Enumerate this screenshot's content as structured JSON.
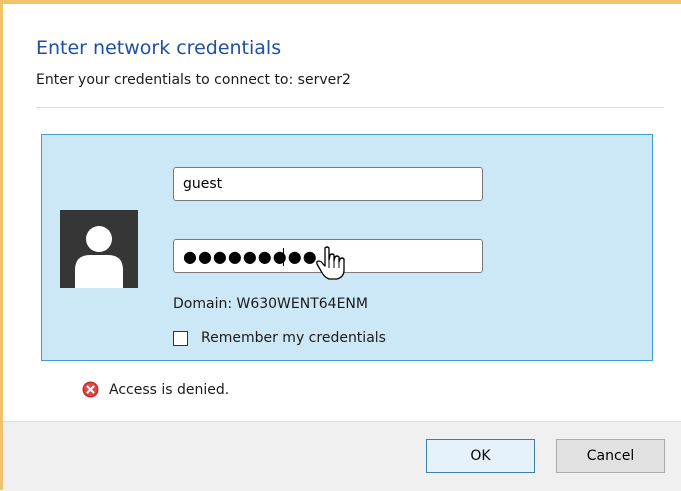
{
  "dialog": {
    "title": "Enter network credentials",
    "subtitle": "Enter your credentials to connect to: server2"
  },
  "credentials": {
    "username_value": "guest",
    "password_masked": "●●●●●●●●●",
    "domain_text": "Domain: W630WENT64ENM",
    "remember_label": "Remember my credentials",
    "remember_checked": false
  },
  "error": {
    "message": "Access is denied.",
    "icon": "error-x-icon"
  },
  "buttons": {
    "ok_label": "OK",
    "cancel_label": "Cancel"
  },
  "colors": {
    "title": "#1e4fa6",
    "tile_background": "#cce8f6",
    "tile_border": "#3d9fd9",
    "window_frame": "#f0c36b",
    "error_icon": "#c62828"
  }
}
